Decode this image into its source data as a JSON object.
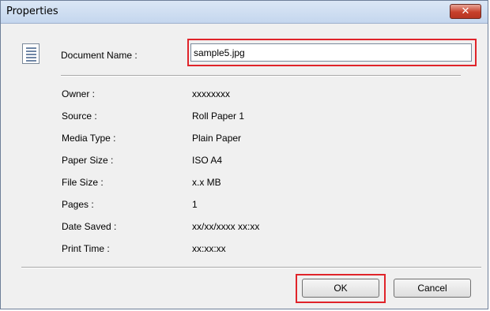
{
  "window": {
    "title": "Properties",
    "close_glyph": "✕"
  },
  "document_name": {
    "label": "Document Name :",
    "value": "sample5.jpg"
  },
  "properties": [
    {
      "label": "Owner :",
      "value": "xxxxxxxx"
    },
    {
      "label": "Source :",
      "value": "Roll Paper 1"
    },
    {
      "label": "Media Type :",
      "value": "Plain Paper"
    },
    {
      "label": "Paper Size :",
      "value": "ISO A4"
    },
    {
      "label": "File Size :",
      "value": "x.x MB"
    },
    {
      "label": "Pages :",
      "value": "1"
    },
    {
      "label": "Date Saved :",
      "value": "xx/xx/xxxx xx:xx"
    },
    {
      "label": "Print Time :",
      "value": "xx:xx:xx"
    }
  ],
  "buttons": {
    "ok": "OK",
    "cancel": "Cancel"
  },
  "colors": {
    "highlight": "#e0242a",
    "titlebar": "#c4d6ee",
    "close_button": "#c7402b"
  },
  "icons": {
    "document": "document-icon",
    "close": "close-icon"
  }
}
